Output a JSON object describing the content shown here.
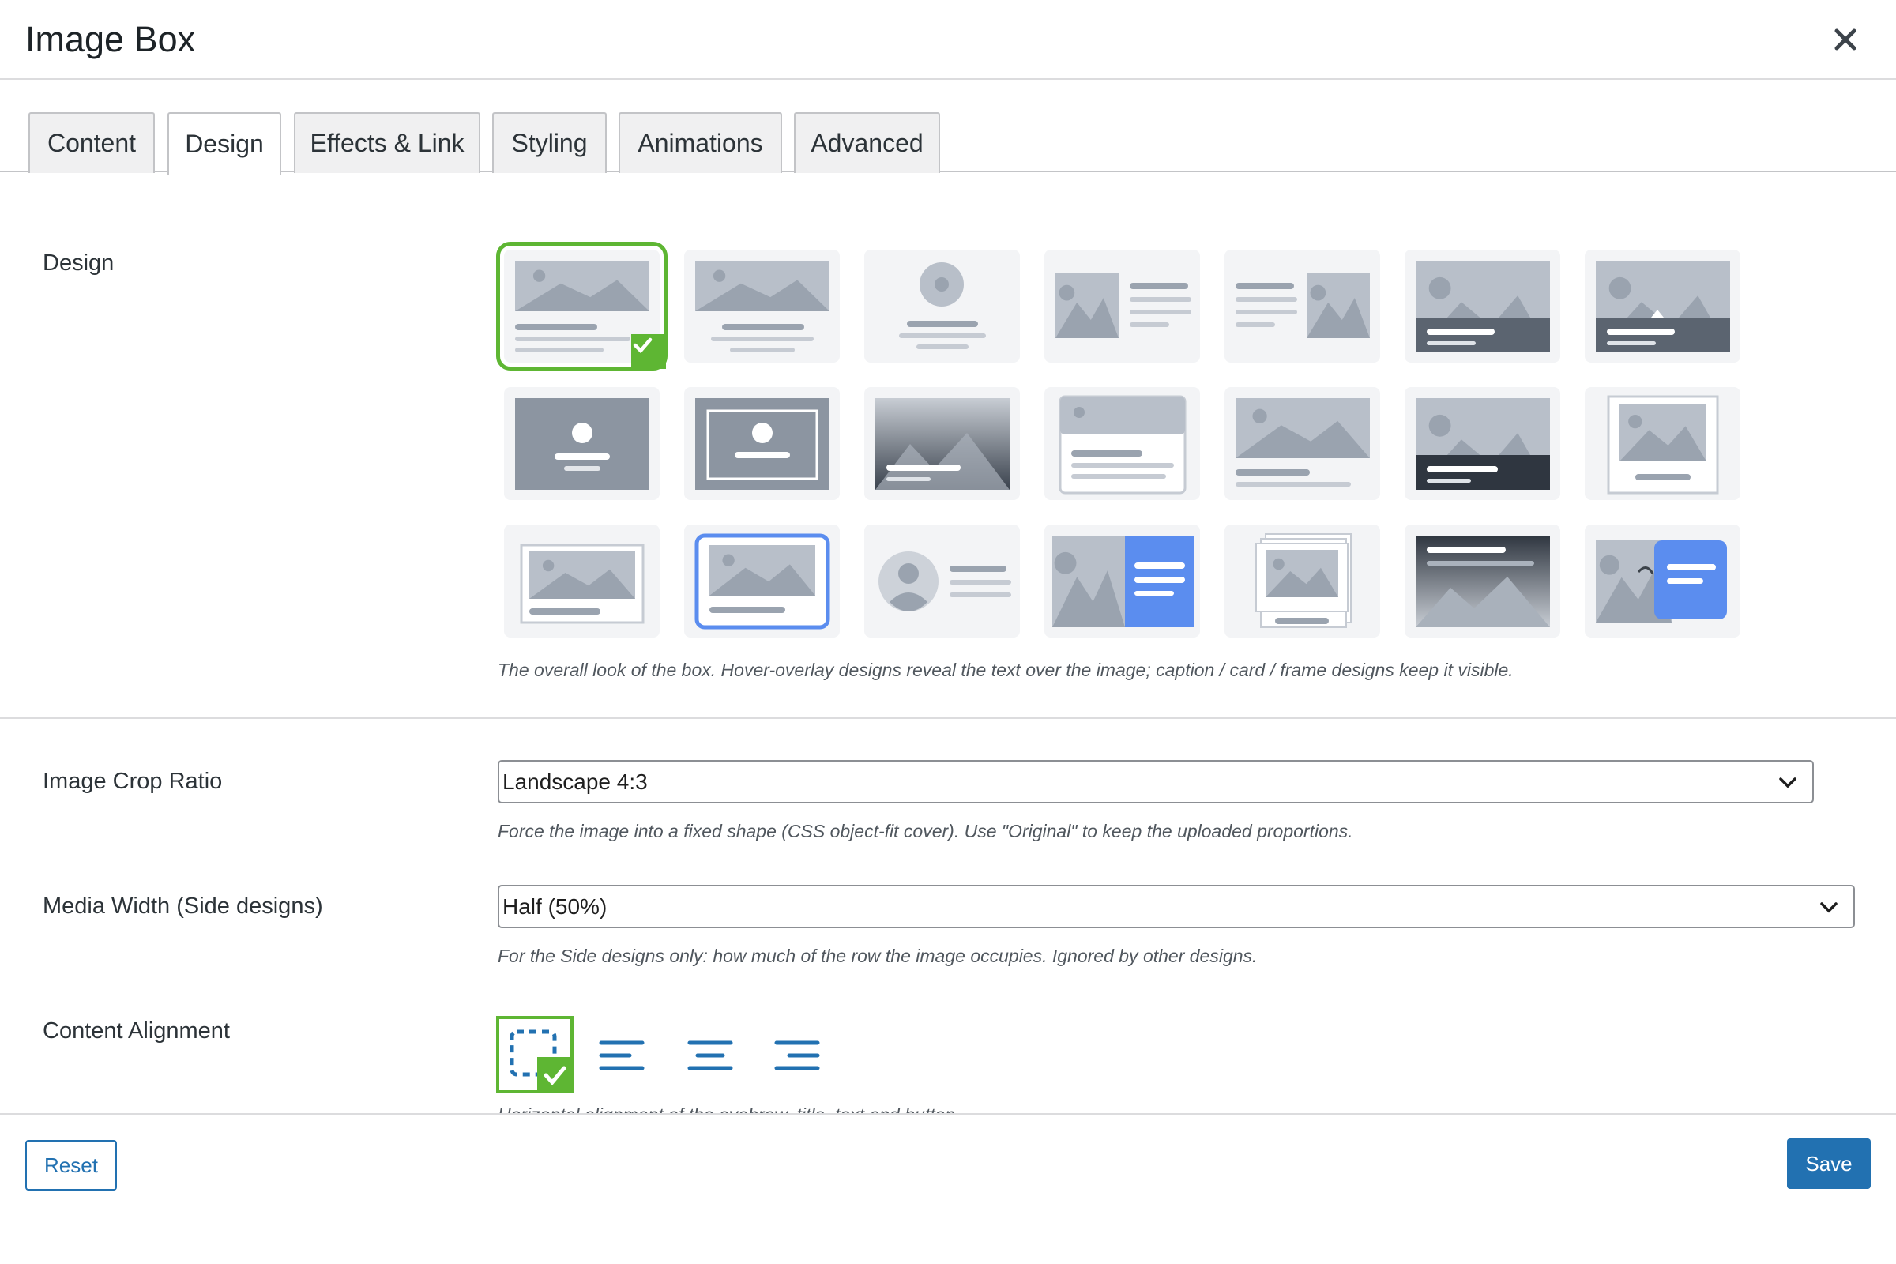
{
  "dialog": {
    "title": "Image Box"
  },
  "tabs": [
    {
      "label": "Content"
    },
    {
      "label": "Design",
      "active": true
    },
    {
      "label": "Effects & Link"
    },
    {
      "label": "Styling"
    },
    {
      "label": "Animations"
    },
    {
      "label": "Advanced"
    }
  ],
  "design": {
    "label": "Design",
    "help": "The overall look of the box. Hover-overlay designs reveal the text over the image; caption / card / frame designs keep it visible.",
    "selected_index": 0
  },
  "crop": {
    "label": "Image Crop Ratio",
    "value": "Landscape 4:3",
    "help": "Force the image into a fixed shape (CSS object-fit cover). Use \"Original\" to keep the uploaded proportions."
  },
  "media_width": {
    "label": "Media Width (Side designs)",
    "value": "Half (50%)",
    "help": "For the Side designs only: how much of the row the image occupies. Ignored by other designs."
  },
  "alignment": {
    "label": "Content Alignment",
    "help": "Horizontal alignment of the eyebrow, title, text and button.",
    "options": [
      "inherit-icon",
      "align-left-icon",
      "align-center-icon",
      "align-right-icon"
    ],
    "selected_index": 0
  },
  "footer": {
    "reset_label": "Reset",
    "save_label": "Save"
  },
  "colors": {
    "accent": "#2271b1",
    "selected": "#5eb633",
    "placeholder": "#b8bfc9",
    "tile_bg": "#f3f4f6"
  }
}
